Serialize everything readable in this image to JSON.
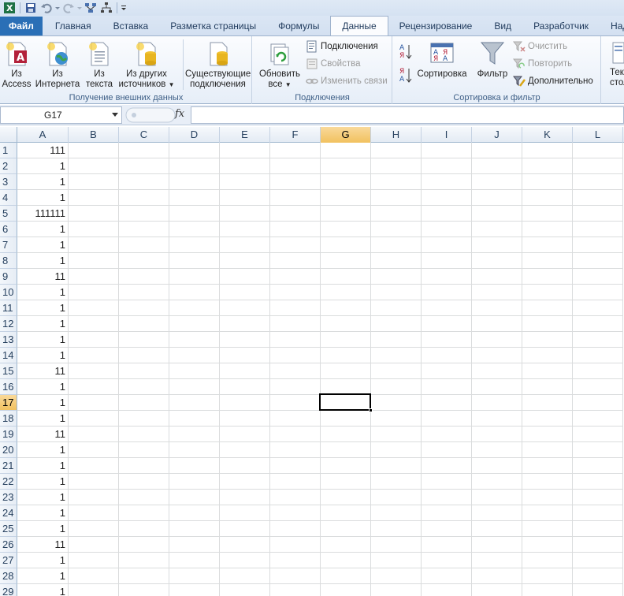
{
  "window": {
    "app": "Microsoft Excel"
  },
  "tabs": {
    "file": "Файл",
    "home": "Главная",
    "insert": "Вставка",
    "page_layout": "Разметка страницы",
    "formulas": "Формулы",
    "data": "Данные",
    "review": "Рецензирование",
    "view": "Вид",
    "developer": "Разработчик",
    "addins": "Надстро"
  },
  "ribbon": {
    "external": {
      "label": "Получение внешних данных",
      "access_l1": "Из",
      "access_l2": "Access",
      "web_l1": "Из",
      "web_l2": "Интернета",
      "text_l1": "Из",
      "text_l2": "текста",
      "other_l1": "Из других",
      "other_l2": "источников",
      "existing_l1": "Существующие",
      "existing_l2": "подключения"
    },
    "connections": {
      "label": "Подключения",
      "refresh_l1": "Обновить",
      "refresh_l2": "все",
      "connections": "Подключения",
      "properties": "Свойства",
      "edit_links": "Изменить связи"
    },
    "sort_filter": {
      "label": "Сортировка и фильтр",
      "sort": "Сортировка",
      "filter": "Фильтр",
      "clear": "Очистить",
      "reapply": "Повторить",
      "advanced": "Дополнительно"
    },
    "tools": {
      "l1": "Тек",
      "l2": "стол"
    }
  },
  "formula_bar": {
    "name_box": "G17",
    "fx": "fx",
    "formula": ""
  },
  "sheet": {
    "columns": [
      "A",
      "B",
      "C",
      "D",
      "E",
      "F",
      "G",
      "H",
      "I",
      "J",
      "K",
      "L"
    ],
    "selected_column": "G",
    "selected_row": 17,
    "rows": [
      {
        "n": "1",
        "a": "111"
      },
      {
        "n": "2",
        "a": "1"
      },
      {
        "n": "3",
        "a": "1"
      },
      {
        "n": "4",
        "a": "1"
      },
      {
        "n": "5",
        "a": "111111"
      },
      {
        "n": "6",
        "a": "1"
      },
      {
        "n": "7",
        "a": "1"
      },
      {
        "n": "8",
        "a": "1"
      },
      {
        "n": "9",
        "a": "11"
      },
      {
        "n": "10",
        "a": "1"
      },
      {
        "n": "11",
        "a": "1"
      },
      {
        "n": "12",
        "a": "1"
      },
      {
        "n": "13",
        "a": "1"
      },
      {
        "n": "14",
        "a": "1"
      },
      {
        "n": "15",
        "a": "11"
      },
      {
        "n": "16",
        "a": "1"
      },
      {
        "n": "17",
        "a": "1"
      },
      {
        "n": "18",
        "a": "1"
      },
      {
        "n": "19",
        "a": "11"
      },
      {
        "n": "20",
        "a": "1"
      },
      {
        "n": "21",
        "a": "1"
      },
      {
        "n": "22",
        "a": "1"
      },
      {
        "n": "23",
        "a": "1"
      },
      {
        "n": "24",
        "a": "1"
      },
      {
        "n": "25",
        "a": "1"
      },
      {
        "n": "26",
        "a": "11"
      },
      {
        "n": "27",
        "a": "1"
      },
      {
        "n": "28",
        "a": "1"
      },
      {
        "n": "29",
        "a": "1"
      }
    ]
  }
}
